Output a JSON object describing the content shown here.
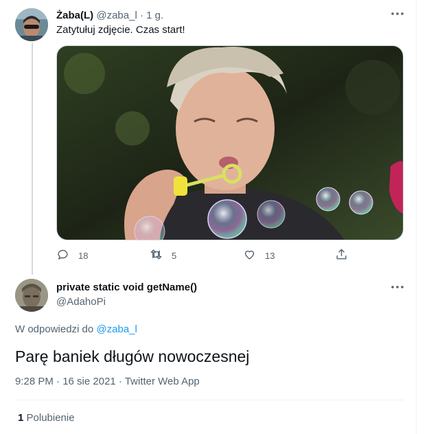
{
  "tweet": {
    "author": "Żaba(L)",
    "handle": "@zaba_l",
    "time": "· 1 g.",
    "text": "Zatytułuj zdjęcie. Czas start!",
    "stats": {
      "replies": "18",
      "retweets": "5",
      "likes": "13"
    }
  },
  "reply": {
    "author": "private static void getName()",
    "handle": "@AdahoPi",
    "reply_prefix": "W odpowiedzi do",
    "reply_to": "@zaba_l",
    "text": "Parę baniek długów nowoczesnej",
    "meta": "9:28 PM · 16 sie 2021 · Twitter Web App",
    "likes_count": "1",
    "likes_label": "Polubienie"
  },
  "icons": [
    "more-icon",
    "reply-icon",
    "retweet-icon",
    "like-icon",
    "share-icon"
  ],
  "colors": {
    "accent": "#1d9bf0",
    "muted": "#536471",
    "text": "#0f1419"
  }
}
